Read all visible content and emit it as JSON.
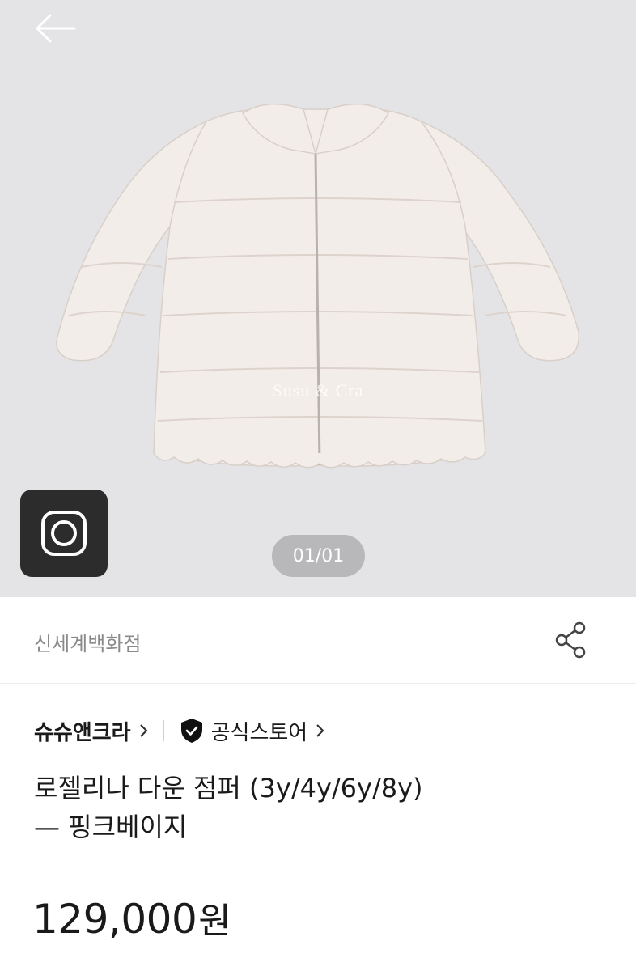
{
  "gallery": {
    "counter": "01/01",
    "watermark": "Susu & Cra",
    "back_icon": "arrow-left-icon",
    "instagram_icon": "camera-icon"
  },
  "store": {
    "name": "신세계백화점",
    "share_icon": "share-icon"
  },
  "brand": {
    "name": "슈슈앤크라",
    "official_label": "공식스토어"
  },
  "product": {
    "title_line1": "로젤리나 다운 점퍼 (3y/4y/6y/8y)",
    "title_line2": "— 핑크베이지",
    "price": "129,000",
    "price_unit": "원"
  },
  "colors": {
    "gallery_bg": "#e4e4e6",
    "store_text": "#8a8a8a",
    "counter_bg": "#b8b8ba"
  }
}
